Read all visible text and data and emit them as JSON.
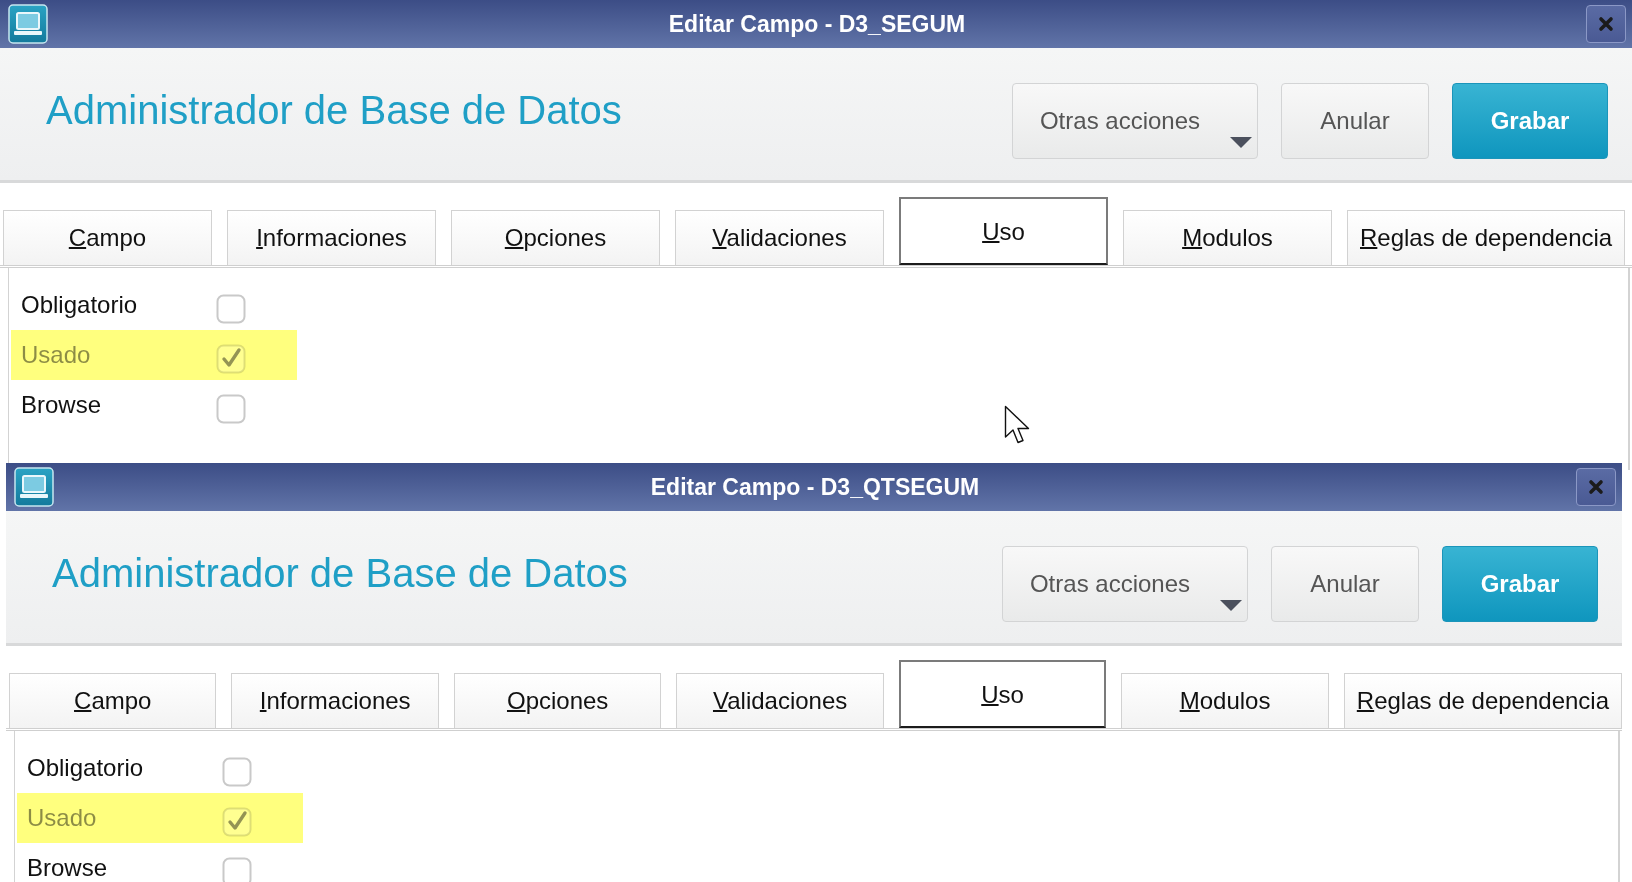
{
  "windows": [
    {
      "title": "Editar Campo - D3_SEGUM",
      "heading": "Administrador de Base de Datos",
      "buttons": [
        {
          "label": "Otras acciones",
          "kind": "menu"
        },
        {
          "label": "Anular",
          "kind": "plain"
        },
        {
          "label": "Grabar",
          "kind": "primary"
        }
      ],
      "tabs": [
        {
          "label": "Campo",
          "selected": false
        },
        {
          "label": "Informaciones",
          "selected": false
        },
        {
          "label": "Opciones",
          "selected": false
        },
        {
          "label": "Validaciones",
          "selected": false
        },
        {
          "label": "Uso",
          "selected": true
        },
        {
          "label": "Modulos",
          "selected": false
        },
        {
          "label": "Reglas de dependencia",
          "selected": false
        }
      ],
      "fields": [
        {
          "label": "Obligatorio",
          "checked": false,
          "disabled": false,
          "highlighted": false
        },
        {
          "label": "Usado",
          "checked": true,
          "disabled": true,
          "highlighted": true
        },
        {
          "label": "Browse",
          "checked": false,
          "disabled": false,
          "highlighted": false
        }
      ]
    },
    {
      "title": "Editar Campo - D3_QTSEGUM",
      "heading": "Administrador de Base de Datos",
      "buttons": [
        {
          "label": "Otras acciones",
          "kind": "menu"
        },
        {
          "label": "Anular",
          "kind": "plain"
        },
        {
          "label": "Grabar",
          "kind": "primary"
        }
      ],
      "tabs": [
        {
          "label": "Campo",
          "selected": false
        },
        {
          "label": "Informaciones",
          "selected": false
        },
        {
          "label": "Opciones",
          "selected": false
        },
        {
          "label": "Validaciones",
          "selected": false
        },
        {
          "label": "Uso",
          "selected": true
        },
        {
          "label": "Modulos",
          "selected": false
        },
        {
          "label": "Reglas de dependencia",
          "selected": false
        }
      ],
      "fields": [
        {
          "label": "Obligatorio",
          "checked": false,
          "disabled": false,
          "highlighted": false
        },
        {
          "label": "Usado",
          "checked": true,
          "disabled": true,
          "highlighted": true
        },
        {
          "label": "Browse",
          "checked": false,
          "disabled": false,
          "highlighted": false
        }
      ]
    }
  ]
}
